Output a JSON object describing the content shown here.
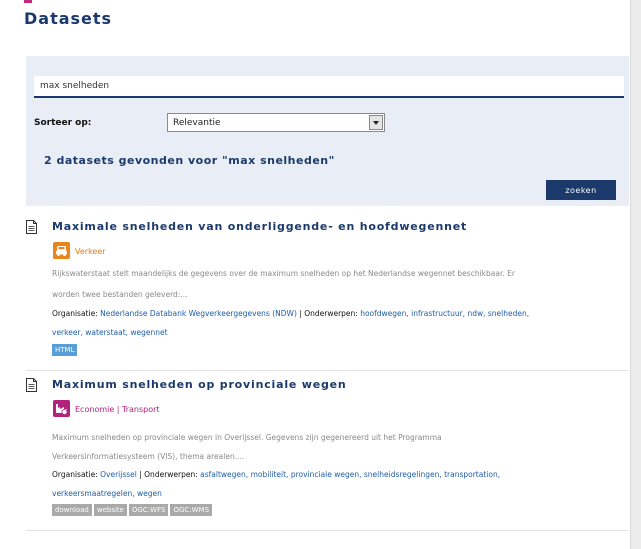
{
  "page": {
    "title": "Datasets"
  },
  "search": {
    "query": "max snelheden",
    "sort_label": "Sorteer op:",
    "sort_selected": "Relevantie",
    "results_text": "2 datasets gevonden voor \"max snelheden\"",
    "submit_label": "zoeken"
  },
  "colors": {
    "brand_navy": "#1b3a6b",
    "link_blue": "#1f5ea8",
    "panel_bg": "#e9eef6",
    "theme_orange": "#e8861d",
    "theme_magenta": "#b3237c"
  },
  "results": [
    {
      "title": "Maximale snelheden van onderliggende- en hoofdwegennet",
      "theme_icon": "car-icon",
      "theme": "Verkeer",
      "description_1": "Rijkswaterstaat stelt maandelijks de gegevens over de maximum snelheden op het Nederlandse wegennet beschikbaar. Er",
      "description_2": "worden twee bestanden geleverd:...",
      "org_label": "Organisatie:",
      "organisation": "Nederlandse Databank Wegverkeergegevens (NDW)",
      "subjects_label": "Onderwerpen:",
      "subjects_line_1": "hoofdwegen, infrastructuur, ndw, snelheden,",
      "subjects_line_2": "verkeer, waterstaat, wegennet",
      "formats": [
        "HTML"
      ]
    },
    {
      "title": "Maximum snelheden op provinciale wegen",
      "theme_icon": "factory-icon",
      "theme": "Economie | Transport",
      "description_1": "Maximum snelheden op provinciale wegen in Overijssel. Gegevens zijn gegenereerd uit het Programma",
      "description_2": "Verkeersinformatiesysteem (VIS), thema arealen....",
      "org_label": "Organisatie:",
      "organisation": "Overijssel",
      "subjects_label": "Onderwerpen:",
      "subjects_line_1": "asfaltwegen, mobiliteit, provinciale wegen, snelheidsregelingen, transportation,",
      "subjects_line_2": "verkeersmaatregelen, wegen",
      "formats": [
        "download",
        "website",
        "OGC:WFS",
        "OGC:WMS"
      ]
    }
  ]
}
